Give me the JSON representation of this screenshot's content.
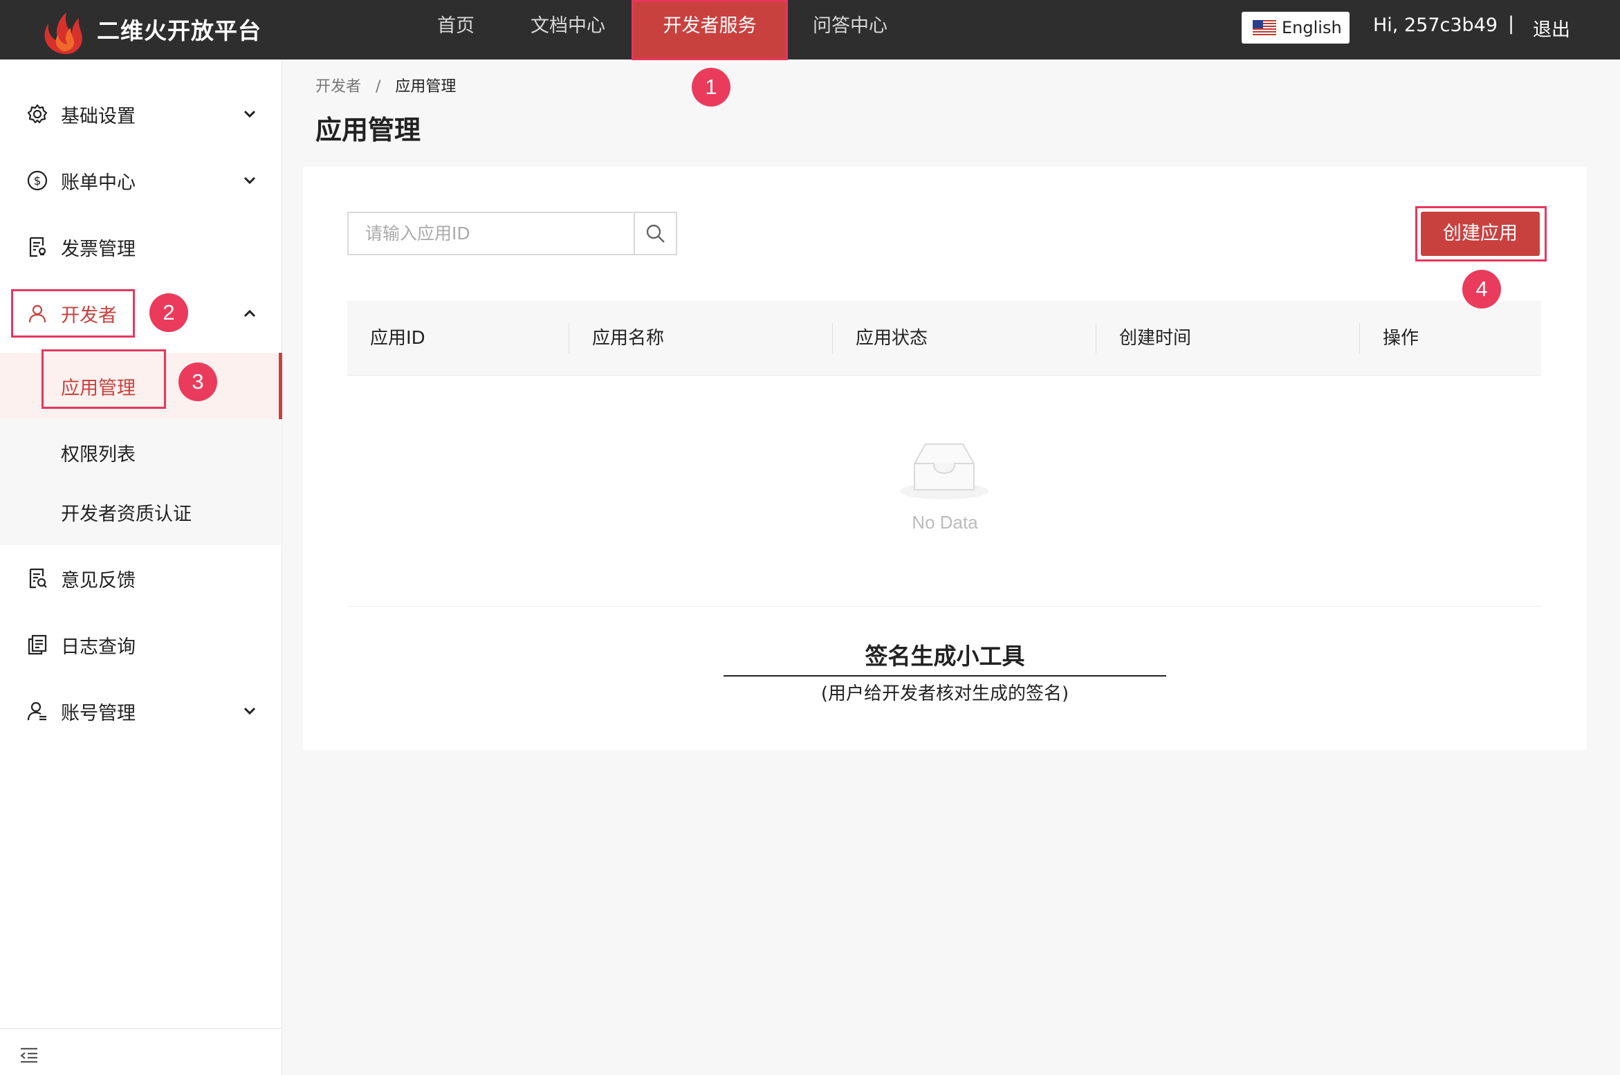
{
  "header": {
    "brand": "二维火开放平台",
    "nav": [
      "首页",
      "文档中心",
      "开发者服务",
      "问答中心"
    ],
    "active_nav": "开发者服务",
    "language": "English",
    "greeting": "Hi, 257c3b49",
    "separator": "|",
    "logout": "退出"
  },
  "sidebar": {
    "items": [
      {
        "label": "基础设置",
        "icon": "gear-icon",
        "expandable": true
      },
      {
        "label": "账单中心",
        "icon": "dollar-circle-icon",
        "expandable": true
      },
      {
        "label": "发票管理",
        "icon": "invoice-icon",
        "expandable": false
      },
      {
        "label": "开发者",
        "icon": "user-icon",
        "expandable": true,
        "expanded": true
      },
      {
        "label": "应用管理",
        "sub": true,
        "selected": true
      },
      {
        "label": "权限列表",
        "sub": true
      },
      {
        "label": "开发者资质认证",
        "sub": true
      },
      {
        "label": "意见反馈",
        "icon": "feedback-icon",
        "expandable": false
      },
      {
        "label": "日志查询",
        "icon": "log-icon",
        "expandable": false
      },
      {
        "label": "账号管理",
        "icon": "account-icon",
        "expandable": true
      }
    ]
  },
  "breadcrumb": {
    "parent": "开发者",
    "sep": "/",
    "current": "应用管理"
  },
  "page_title": "应用管理",
  "search": {
    "placeholder": "请输入应用ID"
  },
  "create_button": "创建应用",
  "table": {
    "columns": [
      "应用ID",
      "应用名称",
      "应用状态",
      "创建时间",
      "操作"
    ],
    "empty_text": "No Data"
  },
  "tool": {
    "title": "签名生成小工具",
    "subtitle": "(用户给开发者核对生成的签名)"
  },
  "annotations": [
    "1",
    "2",
    "3",
    "4"
  ],
  "colors": {
    "accent": "#c9413f",
    "topbar": "#2e2e2e",
    "annotation": "#e8365d"
  }
}
